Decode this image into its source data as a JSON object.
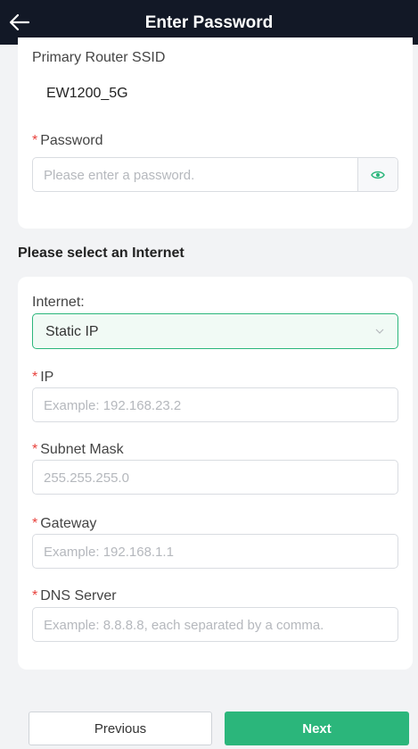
{
  "header": {
    "title": "Enter Password",
    "back_icon": "arrow-left-icon"
  },
  "wifi": {
    "ssid_label": "Primary Router SSID",
    "ssid_value": "EW1200_5G",
    "required_mark": "*",
    "password_label": "Password",
    "password_placeholder": "Please enter a password.",
    "eye_icon": "eye-icon"
  },
  "section_title": "Please select an Internet",
  "internet": {
    "label": "Internet:",
    "selected": "Static IP",
    "fields": {
      "ip": {
        "label": "IP",
        "placeholder": "Example: 192.168.23.2"
      },
      "mask": {
        "label": "Subnet Mask",
        "placeholder": "255.255.255.0"
      },
      "gateway": {
        "label": "Gateway",
        "placeholder": "Example: 192.168.1.1"
      },
      "dns": {
        "label": "DNS Server",
        "placeholder": "Example: 8.8.8.8, each separated by a comma."
      }
    }
  },
  "buttons": {
    "previous": "Previous",
    "next": "Next"
  },
  "colors": {
    "header_bg": "#121826",
    "accent": "#2bb67b",
    "required": "#e8413c"
  }
}
